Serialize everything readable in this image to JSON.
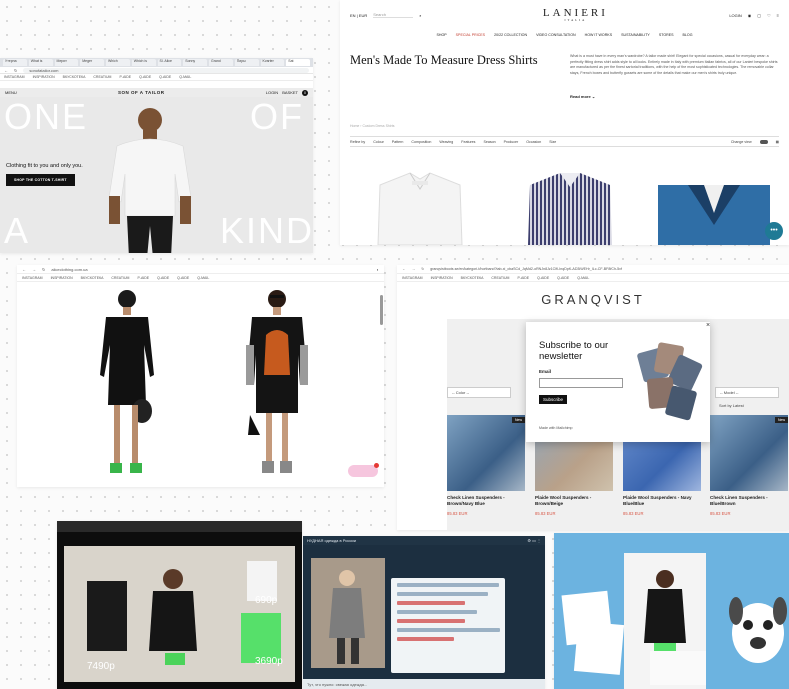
{
  "sonofatailor": {
    "tabs": [
      "Утерна",
      "What is",
      "Мерит",
      "Meger",
      "Which",
      "Which is",
      "Sl. Alice",
      "Sonny",
      "Grand",
      "Пиры",
      "Kvarter",
      "Sat"
    ],
    "url": "sonofatailor.com",
    "bookmarks": [
      "INSTAGRAM",
      "INSPIRATION",
      "ВКУСКОТЕКА",
      "CREATIUM",
      "P-AIDE",
      "Q-AIDE",
      "Q-AIDE",
      "Q-MAIL"
    ],
    "nav_menu": "MENU",
    "brand": "SON OF A TAILOR",
    "nav_login": "LOGIN",
    "nav_basket": "BASKET",
    "basket_count": "0",
    "word_one": "ONE",
    "word_of": "OF",
    "word_a": "A",
    "word_kind": "KIND",
    "tagline": "Clothing fit to you and only you.",
    "cta": "SHOP THE COTTON T-SHIRT"
  },
  "lanieri": {
    "lang": "EN | EUR",
    "search_placeholder": "Search",
    "logo": "LANIERI",
    "logo_sub": "ITALIA",
    "login": "LOGIN",
    "menu": [
      "SHOP",
      "SPECIAL PRICES",
      "20/22 COLLECTION",
      "VIDEO CONSULTATION",
      "HOW IT WORKS",
      "SUSTAINABILITY",
      "STORES",
      "BLOG"
    ],
    "title": "Men's Made To Measure Dress Shirts",
    "description": "What is a must have in every man's wardrobe? A tailor made shirt! Elegant for special occasions, casual for everyday wear: a perfectly fitting dress shirt adds style to all looks. Entirely made in Italy with premium Italian fabrics, all of our Lanieri bespoke shirts are manufactured as per the finest sartorial traditions, with the help of the most sophisticated technologies. The removable collar stays, French boxes and butterfly gussets are some of the details that make our men's shirts truly unique.",
    "read_more": "Read more",
    "breadcrumb": "Home › Custom Dress Shirts",
    "filters": [
      "Refine by",
      "Colour",
      "Pattern",
      "Composition",
      "Weaving",
      "Features",
      "Season",
      "Producer",
      "Occasion",
      "Size"
    ],
    "change_view": "Change view"
  },
  "alice": {
    "url": "aliceclothing.com.ua",
    "bookmarks": [
      "INSTAGRAM",
      "INSPIRATION",
      "ВКУСКОТЕКА",
      "CREATIUM",
      "P-AIDE",
      "Q-AIDE",
      "Q-AIDE",
      "Q-MAIL"
    ]
  },
  "granqvist": {
    "url": "granqvistboots.se/en/kategori-t/hortband?tab-xi_cbaSCd_JqMd2-oRNJn8Jz1ClfI-InqDpK-AD3iWEHr_ILc-CF-BF8fCh-5xf",
    "bookmarks": [
      "INSTAGRAM",
      "INSPIRATION",
      "ВКУСКОТЕКА",
      "CREATIUM",
      "P-AIDE",
      "Q-AIDE",
      "Q-AIDE",
      "Q-MAIL"
    ],
    "logo": "GRANQVIST",
    "filter_color": "-- Color --",
    "filter_model": "-- Model --",
    "sort": "Sort by Latest",
    "popup_title": "Subscribe to our newsletter",
    "popup_email_label": "Email",
    "popup_button": "Subscribe",
    "popup_footer": "Made with Mailchimp",
    "close": "×",
    "badge_new": "New",
    "products": [
      {
        "name": "Check Linen Suspenders - Brown/Navy Blue",
        "price": "85.83 EUR"
      },
      {
        "name": "Plaide Wool Suspenders - Brown/Beige",
        "price": "85.83 EUR"
      },
      {
        "name": "Plaide Wool Suspenders - Navy Blue/Blue",
        "price": "85.83 EUR"
      },
      {
        "name": "Check Linen Suspenders - Blue/Brown",
        "price": "85.83 EUR"
      }
    ]
  },
  "video1": {
    "price_left": "7490р",
    "price_mid": "690р",
    "price_right": "3690р"
  },
  "video2": {
    "title": "НУДНАЯ одежда в России",
    "footer": "Тут, что нужно: свежая одежда..."
  }
}
